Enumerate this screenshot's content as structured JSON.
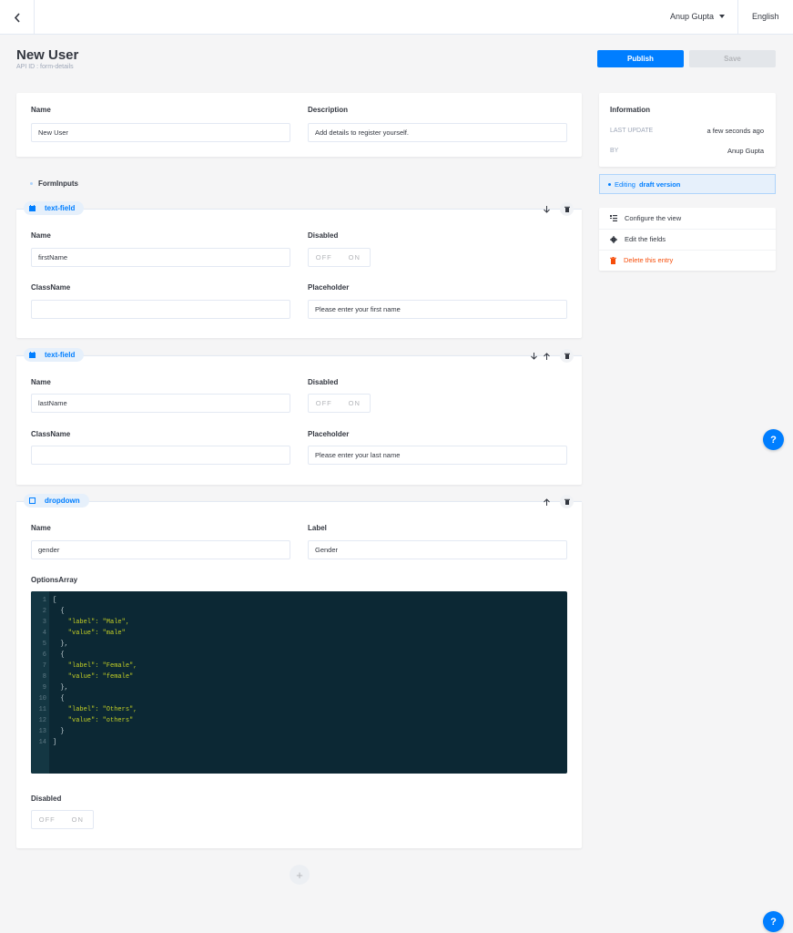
{
  "topbar": {
    "user_name": "Anup Gupta",
    "language": "English"
  },
  "header": {
    "title": "New User",
    "api_id": "API ID : form-details",
    "publish_label": "Publish",
    "save_label": "Save"
  },
  "form": {
    "name_label": "Name",
    "name_value": "New User",
    "description_label": "Description",
    "description_value": "Add details to register yourself."
  },
  "form_inputs": {
    "title": "FormInputs",
    "items": [
      {
        "type": "text-field",
        "name_label": "Name",
        "name_value": "firstName",
        "disabled_label": "Disabled",
        "off": "OFF",
        "on": "ON",
        "classname_label": "ClassName",
        "classname_value": "",
        "placeholder_label": "Placeholder",
        "placeholder_value": "Please enter your first name"
      },
      {
        "type": "text-field",
        "name_label": "Name",
        "name_value": "lastName",
        "disabled_label": "Disabled",
        "off": "OFF",
        "on": "ON",
        "classname_label": "ClassName",
        "classname_value": "",
        "placeholder_label": "Placeholder",
        "placeholder_value": "Please enter your last name"
      },
      {
        "type": "dropdown",
        "name_label": "Name",
        "name_value": "gender",
        "label_label": "Label",
        "label_value": "Gender",
        "options_label": "OptionsArray",
        "disabled_label": "Disabled",
        "off": "OFF",
        "on": "ON",
        "code_lines": [
          "[",
          "  {",
          "    \"label\": \"Male\",",
          "    \"value\": \"male\"",
          "  },",
          "  {",
          "    \"label\": \"Female\",",
          "    \"value\": \"female\"",
          "  },",
          "  {",
          "    \"label\": \"Others\",",
          "    \"value\": \"others\"",
          "  }",
          "]"
        ]
      }
    ]
  },
  "info": {
    "title": "Information",
    "last_update_label": "LAST UPDATE",
    "last_update_value": "a few seconds ago",
    "by_label": "BY",
    "by_value": "Anup Gupta"
  },
  "status": {
    "prefix": "Editing",
    "version": "draft version"
  },
  "actions": {
    "configure": "Configure the view",
    "edit_fields": "Edit the fields",
    "delete": "Delete this entry"
  },
  "help_label": "?",
  "add_label": "+",
  "colors": {
    "primary": "#007eff",
    "danger": "#f64d0a",
    "code_bg": "#0c2834"
  }
}
